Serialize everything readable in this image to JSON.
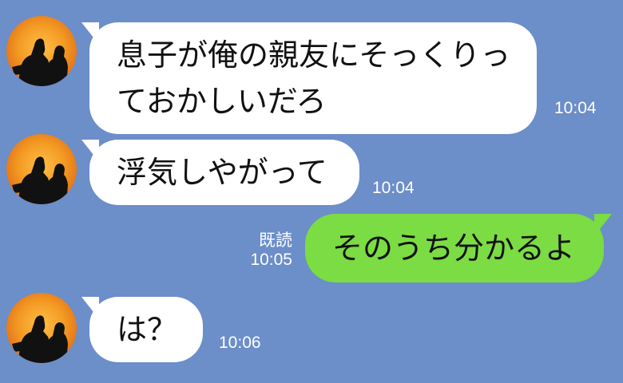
{
  "theme": {
    "background": "#6c8ec9",
    "incoming_bubble": "#ffffff",
    "outgoing_bubble": "#7bdc43",
    "avatar_background": "#f08a1a",
    "meta_text": "#ffffff"
  },
  "messages": [
    {
      "direction": "incoming",
      "lines": [
        "息子が俺の親友にそっくりっ",
        "ておかしいだろ"
      ],
      "time": "10:04",
      "avatar": "silhouette-avatar-icon"
    },
    {
      "direction": "incoming",
      "lines": [
        "浮気しやがって"
      ],
      "time": "10:04",
      "avatar": "silhouette-avatar-icon"
    },
    {
      "direction": "outgoing",
      "lines": [
        "そのうち分かるよ"
      ],
      "time": "10:05",
      "read_label": "既読"
    },
    {
      "direction": "incoming",
      "lines": [
        "は？"
      ],
      "time": "10:06",
      "avatar": "silhouette-avatar-icon"
    }
  ]
}
